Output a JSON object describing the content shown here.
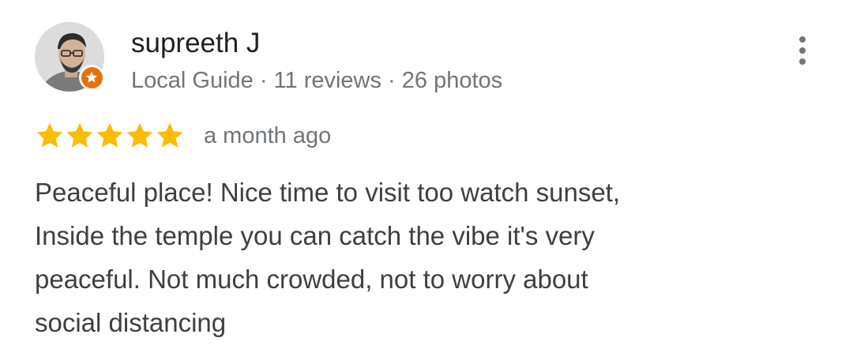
{
  "review": {
    "author": {
      "name": "supreeth J",
      "meta": "Local Guide · 11 reviews · 26 photos",
      "badge_icon": "local-guide-star-icon",
      "badge_color": "#e8710a"
    },
    "rating": {
      "stars": 5,
      "max_stars": 5,
      "star_color": "#fbbc04",
      "date": "a month ago"
    },
    "text_lines": [
      "Peaceful place! Nice time to visit too watch sunset,",
      "Inside the temple you can catch the vibe it's very",
      "peaceful. Not much crowded, not to worry about",
      "social distancing"
    ],
    "menu_icon": "more-vert-icon"
  }
}
